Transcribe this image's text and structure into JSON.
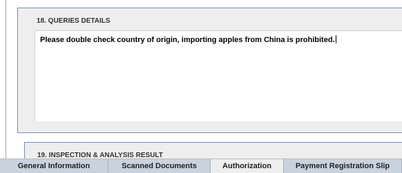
{
  "section18": {
    "title": "18. QUERIES DETAILS",
    "text": "Please double check country of origin, importing apples from China is prohibited."
  },
  "section19": {
    "title": "19. INSPECTION & ANALYSIS RESULT"
  },
  "tabs": [
    {
      "label": "General Information",
      "active": false
    },
    {
      "label": "Scanned Documents",
      "active": false
    },
    {
      "label": "Authorization",
      "active": true
    },
    {
      "label": "Payment Registration Slip",
      "active": false
    }
  ]
}
